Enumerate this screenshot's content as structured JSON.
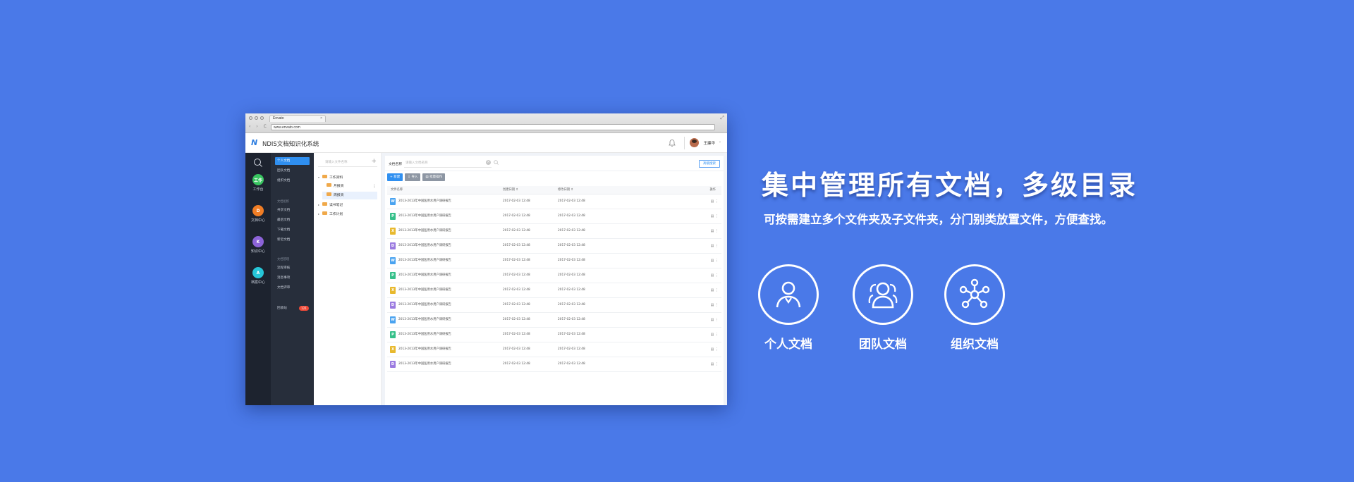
{
  "browser": {
    "tab_title": "Envato",
    "tab_close": "×",
    "url": "www.envato.com",
    "nav_buttons": "‹ › C"
  },
  "app": {
    "logo": "N",
    "title": "NDIS文档知识化系统",
    "user_name": "王建华",
    "user_caret": "⌄"
  },
  "iconbar": {
    "items": [
      {
        "label": "工作台",
        "icon": "workbench-icon",
        "glyph": "工作",
        "color": "#37c45f"
      },
      {
        "label": "文档中心",
        "icon": "document-center-icon",
        "glyph": "D",
        "color": "#f07d25"
      },
      {
        "label": "知识中心",
        "icon": "knowledge-center-icon",
        "glyph": "K",
        "color": "#8c63d8"
      },
      {
        "label": "档案中心",
        "icon": "archive-center-icon",
        "glyph": "A",
        "color": "#26c6d8"
      }
    ]
  },
  "menu": {
    "group1": [
      "个人文档",
      "团队文档",
      "组织文档"
    ],
    "group2_head": "文档组织",
    "group2": [
      "共享文档",
      "最后文档",
      "下载文档",
      "新近文档"
    ],
    "group3_head": "文档管理",
    "group3": [
      "流程审核",
      "消息事项",
      "文档评审"
    ],
    "recycle": "回收站",
    "recycle_badge": "121"
  },
  "tree": {
    "search_placeholder": "请输入文件名称",
    "add": "+",
    "nodes": [
      {
        "label": "工作资料",
        "caret": "▾"
      },
      {
        "label": "月报资",
        "caret": ""
      },
      {
        "label": "周报资",
        "caret": ""
      },
      {
        "label": "读书笔记",
        "caret": "▸"
      },
      {
        "label": "工作计划",
        "caret": "▸"
      }
    ],
    "more": "⋮"
  },
  "filter": {
    "label": "文档名称",
    "placeholder": "请输入文档名称",
    "clear": "×",
    "advanced": "高级搜索"
  },
  "actions": [
    {
      "label": "+ 新建",
      "style": "primary"
    },
    {
      "label": "⇩ 导入",
      "style": "grey"
    },
    {
      "label": "▤ 批量操作",
      "style": "grey"
    }
  ],
  "table": {
    "headers": [
      "文件名称",
      "创建日期 ⇕",
      "修改日期 ⇕",
      "操作"
    ],
    "rows": [
      {
        "type": "W",
        "color": "#4aa3f0",
        "name": "2013-2013年中国医用水用户调研报告",
        "created": "2017-02-03 12:48",
        "modified": "2017-02-03 12:48"
      },
      {
        "type": "P",
        "color": "#36c08a",
        "name": "2013-2013年中国医用水用户调研报告",
        "created": "2017-02-03 12:48",
        "modified": "2017-02-03 12:48"
      },
      {
        "type": "X",
        "color": "#e8b92e",
        "name": "2013-2013年中国医用水用户调研报告",
        "created": "2017-02-03 12:48",
        "modified": "2017-02-03 12:48"
      },
      {
        "type": "D",
        "color": "#9b7be0",
        "name": "2013-2013年中国医用水用户调研报告",
        "created": "2017-02-03 12:48",
        "modified": "2017-02-03 12:48"
      },
      {
        "type": "W",
        "color": "#4aa3f0",
        "name": "2013-2013年中国医用水用户调研报告",
        "created": "2017-02-03 12:48",
        "modified": "2017-02-03 12:48"
      },
      {
        "type": "P",
        "color": "#36c08a",
        "name": "2013-2013年中国医用水用户调研报告",
        "created": "2017-02-03 12:48",
        "modified": "2017-02-03 12:48"
      },
      {
        "type": "X",
        "color": "#e8b92e",
        "name": "2013-2013年中国医用水用户调研报告",
        "created": "2017-02-03 12:48",
        "modified": "2017-02-03 12:48"
      },
      {
        "type": "D",
        "color": "#9b7be0",
        "name": "2013-2013年中国医用水用户调研报告",
        "created": "2017-02-03 12:48",
        "modified": "2017-02-03 12:48"
      },
      {
        "type": "W",
        "color": "#4aa3f0",
        "name": "2013-2013年中国医用水用户调研报告",
        "created": "2017-02-03 12:48",
        "modified": "2017-02-03 12:48"
      },
      {
        "type": "P",
        "color": "#36c08a",
        "name": "2013-2013年中国医用水用户调研报告",
        "created": "2017-02-03 12:48",
        "modified": "2017-02-03 12:48"
      },
      {
        "type": "X",
        "color": "#e8b92e",
        "name": "2013-2013年中国医用水用户调研报告",
        "created": "2017-02-03 12:48",
        "modified": "2017-02-03 12:48"
      },
      {
        "type": "D",
        "color": "#9b7be0",
        "name": "2013-2013年中国医用水用户调研报告",
        "created": "2017-02-03 12:48",
        "modified": "2017-02-03 12:48"
      }
    ],
    "ops": "▤ ⋮"
  },
  "marketing": {
    "headline": "集中管理所有文档，多级目录",
    "subline": "可按需建立多个文件夹及子文件夹，分门别类放置文件，方便查找。",
    "features": [
      {
        "label": "个人文档",
        "icon": "person-icon"
      },
      {
        "label": "团队文档",
        "icon": "team-icon"
      },
      {
        "label": "组织文档",
        "icon": "network-icon"
      }
    ]
  },
  "colors": {
    "background": "#4a79e8",
    "accent": "#2f8ff0",
    "sidebar_dark": "#1d232f",
    "menu_dark": "#272e3b"
  }
}
